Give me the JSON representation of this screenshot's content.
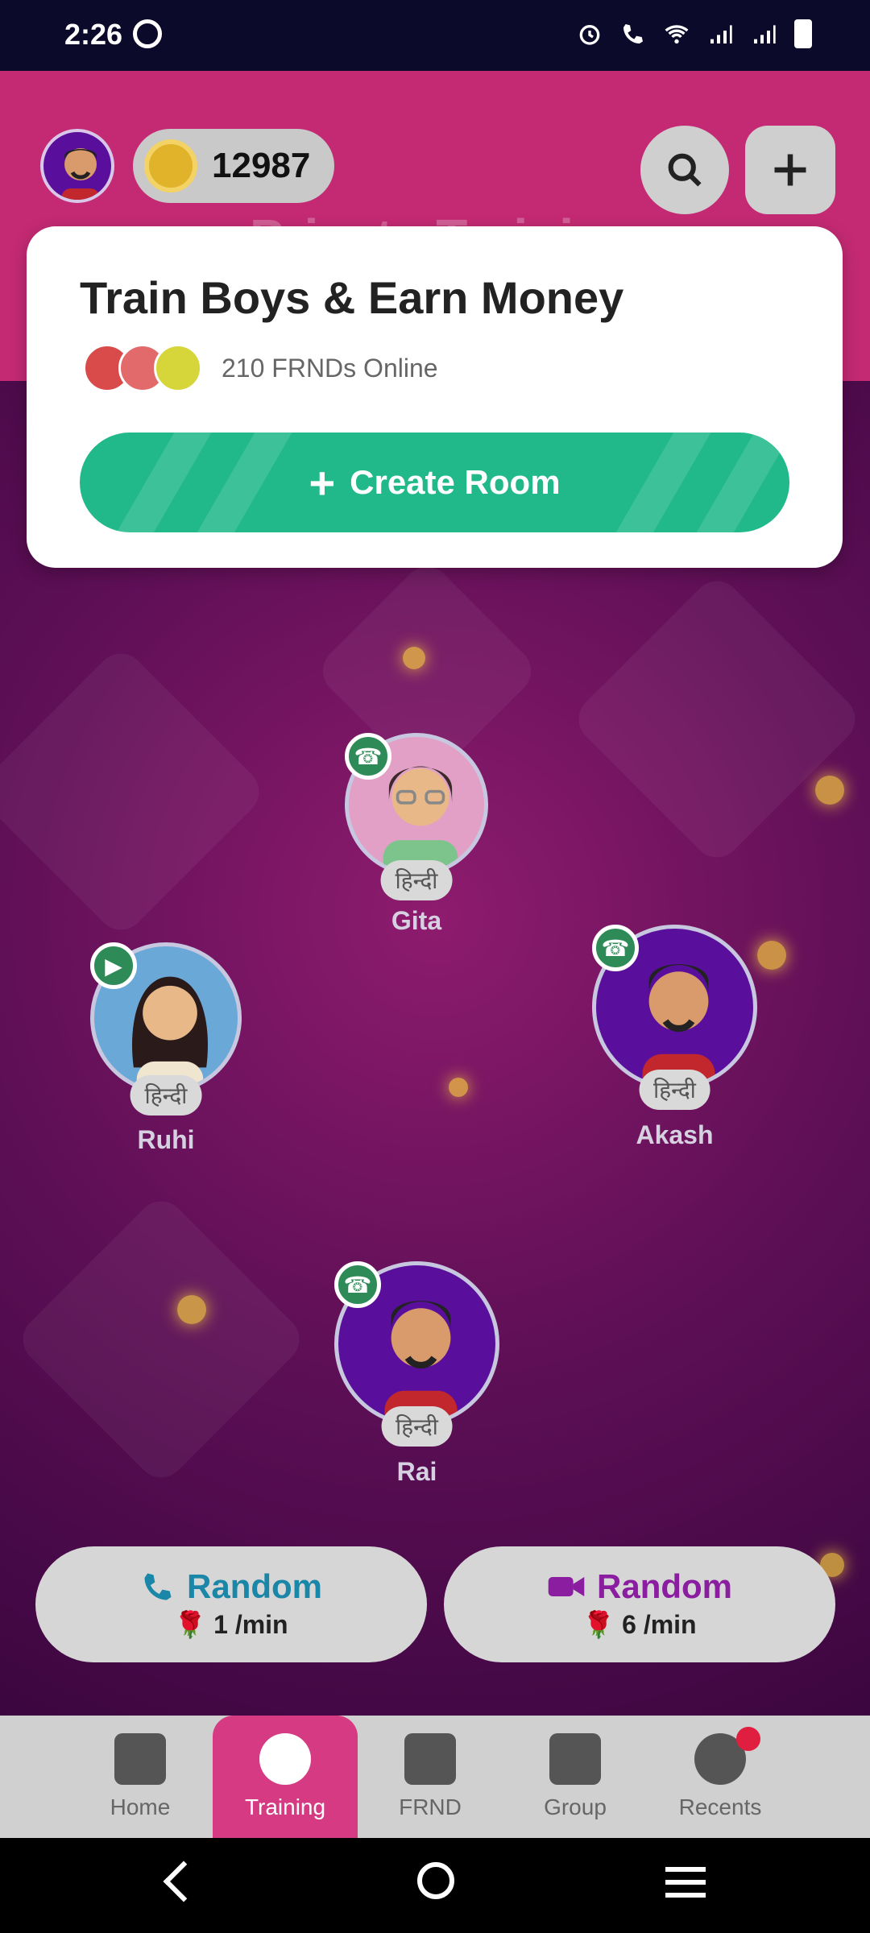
{
  "status_bar": {
    "time": "2:26"
  },
  "header": {
    "coins": "12987",
    "background_title": "Private Training"
  },
  "modal": {
    "title": "Train Boys & Earn Money",
    "online_text": "210 FRNDs Online",
    "create_button": "Create Room"
  },
  "users": [
    {
      "name": "Gita",
      "lang": "हिन्दी"
    },
    {
      "name": "Ruhi",
      "lang": "हिन्दी"
    },
    {
      "name": "Akash",
      "lang": "हिन्दी"
    },
    {
      "name": "Rai",
      "lang": "हिन्दी"
    }
  ],
  "random_audio": {
    "label": "Random",
    "price": "1 /min"
  },
  "random_video": {
    "label": "Random",
    "price": "6 /min"
  },
  "nav": [
    {
      "label": "Home"
    },
    {
      "label": "Training"
    },
    {
      "label": "FRND"
    },
    {
      "label": "Group"
    },
    {
      "label": "Recents"
    }
  ],
  "colors": {
    "brand_pink": "#c42a73",
    "create_green": "#22b98a",
    "audio_blue": "#1a86a8",
    "video_purple": "#8a1da0"
  }
}
